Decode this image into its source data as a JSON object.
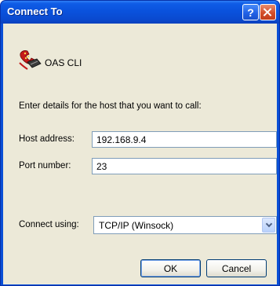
{
  "window": {
    "title": "Connect To",
    "help_label": "?"
  },
  "connection": {
    "name": "OAS CLI",
    "prompt": "Enter details for the host that you want to call:",
    "host_label": "Host address:",
    "host_value": "192.168.9.4",
    "port_label": "Port number:",
    "port_value": "23",
    "connect_label": "Connect using:",
    "connect_value": "TCP/IP (Winsock)"
  },
  "buttons": {
    "ok": "OK",
    "cancel": "Cancel"
  },
  "colors": {
    "titlebar": "#0a52dd",
    "dialog_bg": "#ece9d8",
    "close_button": "#d34e2a"
  },
  "icons": {
    "app": "phone-connection-icon",
    "help": "help-icon",
    "close": "close-icon",
    "dropdown": "chevron-down-icon"
  }
}
